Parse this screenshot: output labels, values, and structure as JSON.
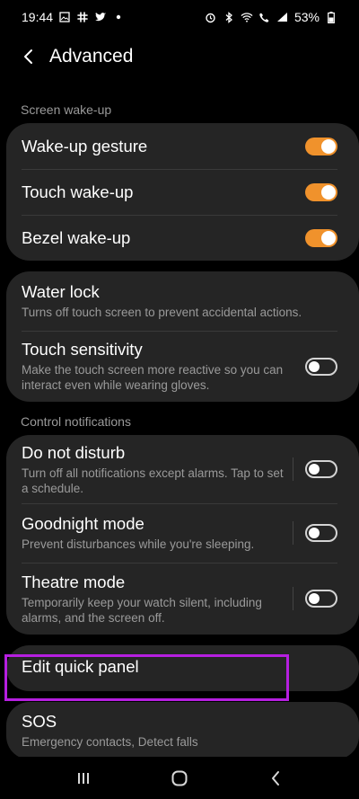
{
  "status_bar": {
    "time": "19:44",
    "battery": "53%",
    "left_icons": [
      "image-icon",
      "slack-icon",
      "twitter-icon",
      "dot-icon"
    ],
    "right_icons": [
      "alarm-icon",
      "bluetooth-icon",
      "wifi-icon",
      "call-icon",
      "signal-icon",
      "battery-icon"
    ]
  },
  "app_bar": {
    "title": "Advanced",
    "back_icon": "chevron-left-icon"
  },
  "sections": {
    "screen_wakeup": "Screen wake-up",
    "control_notifications": "Control notifications"
  },
  "wakeup_items": [
    {
      "title": "Wake-up gesture",
      "enabled": true
    },
    {
      "title": "Touch wake-up",
      "enabled": true
    },
    {
      "title": "Bezel wake-up",
      "enabled": true
    }
  ],
  "water_lock": {
    "title": "Water lock",
    "subtitle": "Turns off touch screen to prevent accidental actions."
  },
  "touch_sensitivity": {
    "title": "Touch sensitivity",
    "subtitle": "Make the touch screen more reactive so you can interact even while wearing gloves.",
    "enabled": false
  },
  "notification_items": [
    {
      "title": "Do not disturb",
      "subtitle": "Turn off all notifications except alarms. Tap to set a schedule.",
      "enabled": false
    },
    {
      "title": "Goodnight mode",
      "subtitle": "Prevent disturbances while you're sleeping.",
      "enabled": false
    },
    {
      "title": "Theatre mode",
      "subtitle": "Temporarily keep your watch silent, including alarms, and the screen off.",
      "enabled": false
    }
  ],
  "edit_quick_panel": {
    "title": "Edit quick panel"
  },
  "sos": {
    "title": "SOS",
    "subtitle": "Emergency contacts, Detect falls"
  },
  "colors": {
    "accent": "#f0922c",
    "highlight": "#b61fe0",
    "card": "#252525"
  },
  "nav_bar": [
    "recents-icon",
    "home-icon",
    "back-icon"
  ]
}
